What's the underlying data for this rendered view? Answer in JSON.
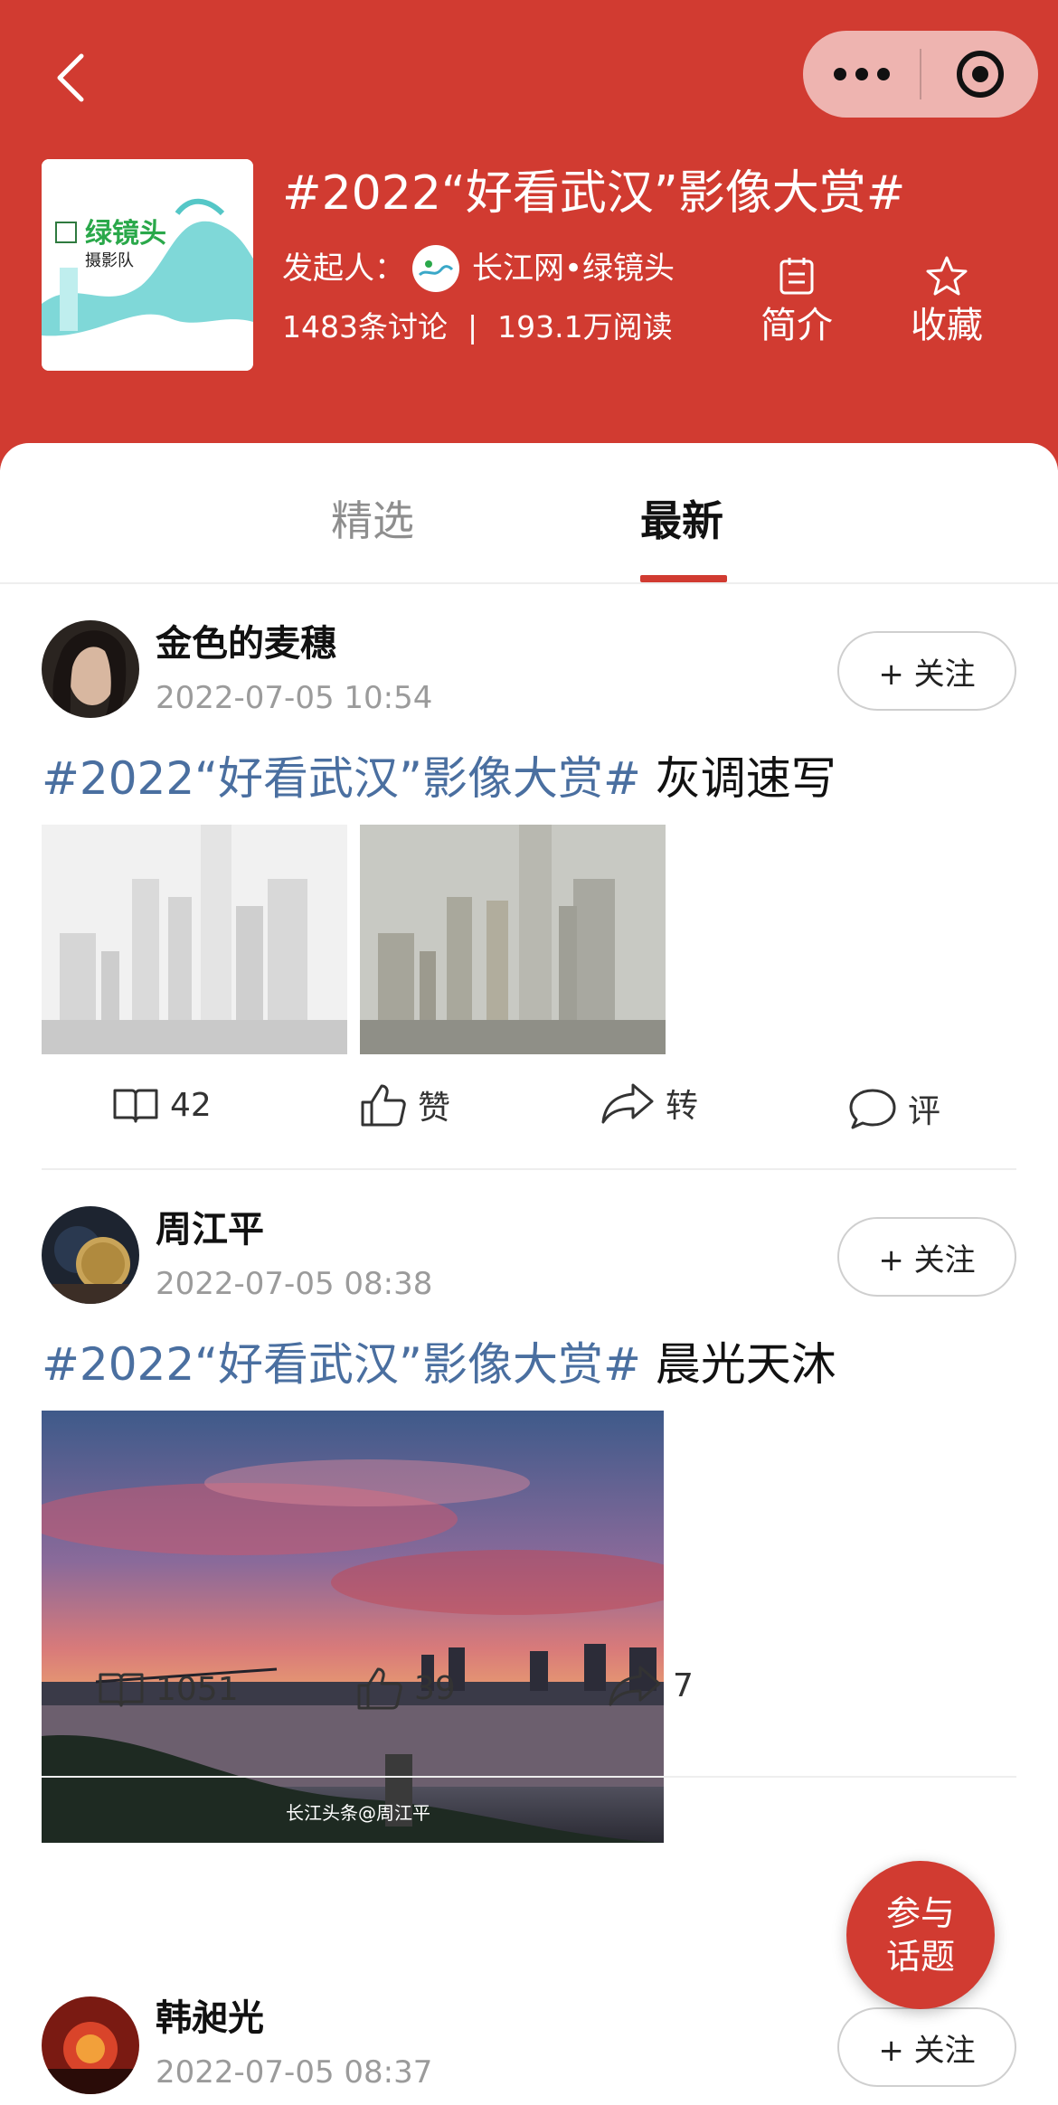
{
  "header": {
    "title": "#2022“好看武汉”影像大赏#",
    "initiator_prefix": "发起人：",
    "initiator_name": "长江网•绿镜头",
    "discussions": "1483条讨论",
    "separator": "|",
    "reads": "193.1万阅读",
    "intro_label": "简介",
    "collect_label": "收藏",
    "cover_text_main": "绿镜头",
    "cover_text_sub": "摄影队"
  },
  "tabs": [
    {
      "label": "精选",
      "active": false
    },
    {
      "label": "最新",
      "active": true
    }
  ],
  "posts": [
    {
      "user": "金色的麦穗",
      "time": "2022-07-05 10:54",
      "follow": "+ 关注",
      "tag": "#2022“好看武汉”影像大赏#",
      "text": " 灰调速写",
      "reads": "42",
      "like": "赞",
      "share": "转",
      "comment": "评"
    },
    {
      "user": "周江平",
      "time": "2022-07-05 08:38",
      "follow": "+ 关注",
      "tag": "#2022“好看武汉”影像大赏#",
      "text": " 晨光天沐",
      "reads": "1051",
      "like": "39",
      "share": "7",
      "watermark": "长江头条@周江平"
    },
    {
      "user": "韩昶光",
      "time": "2022-07-05 08:37",
      "follow": "+ 关注"
    }
  ],
  "fab": {
    "line1": "参与",
    "line2": "话题"
  },
  "colors": {
    "brand_red": "#d13b31",
    "tag_blue": "#4a6fa0"
  }
}
